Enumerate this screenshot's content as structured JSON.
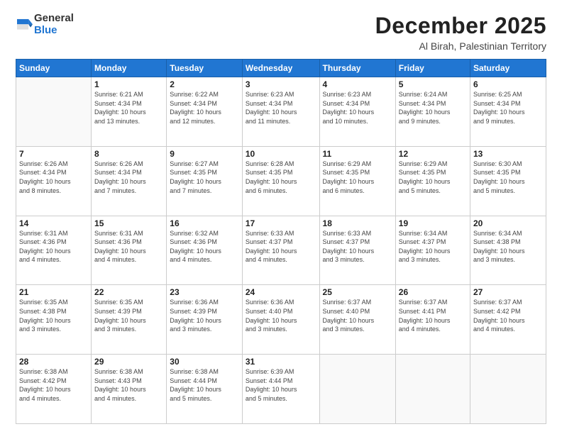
{
  "logo": {
    "general": "General",
    "blue": "Blue"
  },
  "title": {
    "month": "December 2025",
    "location": "Al Birah, Palestinian Territory"
  },
  "header": {
    "days": [
      "Sunday",
      "Monday",
      "Tuesday",
      "Wednesday",
      "Thursday",
      "Friday",
      "Saturday"
    ]
  },
  "weeks": [
    [
      {
        "day": "",
        "info": ""
      },
      {
        "day": "1",
        "info": "Sunrise: 6:21 AM\nSunset: 4:34 PM\nDaylight: 10 hours\nand 13 minutes."
      },
      {
        "day": "2",
        "info": "Sunrise: 6:22 AM\nSunset: 4:34 PM\nDaylight: 10 hours\nand 12 minutes."
      },
      {
        "day": "3",
        "info": "Sunrise: 6:23 AM\nSunset: 4:34 PM\nDaylight: 10 hours\nand 11 minutes."
      },
      {
        "day": "4",
        "info": "Sunrise: 6:23 AM\nSunset: 4:34 PM\nDaylight: 10 hours\nand 10 minutes."
      },
      {
        "day": "5",
        "info": "Sunrise: 6:24 AM\nSunset: 4:34 PM\nDaylight: 10 hours\nand 9 minutes."
      },
      {
        "day": "6",
        "info": "Sunrise: 6:25 AM\nSunset: 4:34 PM\nDaylight: 10 hours\nand 9 minutes."
      }
    ],
    [
      {
        "day": "7",
        "info": "Sunrise: 6:26 AM\nSunset: 4:34 PM\nDaylight: 10 hours\nand 8 minutes."
      },
      {
        "day": "8",
        "info": "Sunrise: 6:26 AM\nSunset: 4:34 PM\nDaylight: 10 hours\nand 7 minutes."
      },
      {
        "day": "9",
        "info": "Sunrise: 6:27 AM\nSunset: 4:35 PM\nDaylight: 10 hours\nand 7 minutes."
      },
      {
        "day": "10",
        "info": "Sunrise: 6:28 AM\nSunset: 4:35 PM\nDaylight: 10 hours\nand 6 minutes."
      },
      {
        "day": "11",
        "info": "Sunrise: 6:29 AM\nSunset: 4:35 PM\nDaylight: 10 hours\nand 6 minutes."
      },
      {
        "day": "12",
        "info": "Sunrise: 6:29 AM\nSunset: 4:35 PM\nDaylight: 10 hours\nand 5 minutes."
      },
      {
        "day": "13",
        "info": "Sunrise: 6:30 AM\nSunset: 4:35 PM\nDaylight: 10 hours\nand 5 minutes."
      }
    ],
    [
      {
        "day": "14",
        "info": "Sunrise: 6:31 AM\nSunset: 4:36 PM\nDaylight: 10 hours\nand 4 minutes."
      },
      {
        "day": "15",
        "info": "Sunrise: 6:31 AM\nSunset: 4:36 PM\nDaylight: 10 hours\nand 4 minutes."
      },
      {
        "day": "16",
        "info": "Sunrise: 6:32 AM\nSunset: 4:36 PM\nDaylight: 10 hours\nand 4 minutes."
      },
      {
        "day": "17",
        "info": "Sunrise: 6:33 AM\nSunset: 4:37 PM\nDaylight: 10 hours\nand 4 minutes."
      },
      {
        "day": "18",
        "info": "Sunrise: 6:33 AM\nSunset: 4:37 PM\nDaylight: 10 hours\nand 3 minutes."
      },
      {
        "day": "19",
        "info": "Sunrise: 6:34 AM\nSunset: 4:37 PM\nDaylight: 10 hours\nand 3 minutes."
      },
      {
        "day": "20",
        "info": "Sunrise: 6:34 AM\nSunset: 4:38 PM\nDaylight: 10 hours\nand 3 minutes."
      }
    ],
    [
      {
        "day": "21",
        "info": "Sunrise: 6:35 AM\nSunset: 4:38 PM\nDaylight: 10 hours\nand 3 minutes."
      },
      {
        "day": "22",
        "info": "Sunrise: 6:35 AM\nSunset: 4:39 PM\nDaylight: 10 hours\nand 3 minutes."
      },
      {
        "day": "23",
        "info": "Sunrise: 6:36 AM\nSunset: 4:39 PM\nDaylight: 10 hours\nand 3 minutes."
      },
      {
        "day": "24",
        "info": "Sunrise: 6:36 AM\nSunset: 4:40 PM\nDaylight: 10 hours\nand 3 minutes."
      },
      {
        "day": "25",
        "info": "Sunrise: 6:37 AM\nSunset: 4:40 PM\nDaylight: 10 hours\nand 3 minutes."
      },
      {
        "day": "26",
        "info": "Sunrise: 6:37 AM\nSunset: 4:41 PM\nDaylight: 10 hours\nand 4 minutes."
      },
      {
        "day": "27",
        "info": "Sunrise: 6:37 AM\nSunset: 4:42 PM\nDaylight: 10 hours\nand 4 minutes."
      }
    ],
    [
      {
        "day": "28",
        "info": "Sunrise: 6:38 AM\nSunset: 4:42 PM\nDaylight: 10 hours\nand 4 minutes."
      },
      {
        "day": "29",
        "info": "Sunrise: 6:38 AM\nSunset: 4:43 PM\nDaylight: 10 hours\nand 4 minutes."
      },
      {
        "day": "30",
        "info": "Sunrise: 6:38 AM\nSunset: 4:44 PM\nDaylight: 10 hours\nand 5 minutes."
      },
      {
        "day": "31",
        "info": "Sunrise: 6:39 AM\nSunset: 4:44 PM\nDaylight: 10 hours\nand 5 minutes."
      },
      {
        "day": "",
        "info": ""
      },
      {
        "day": "",
        "info": ""
      },
      {
        "day": "",
        "info": ""
      }
    ]
  ]
}
